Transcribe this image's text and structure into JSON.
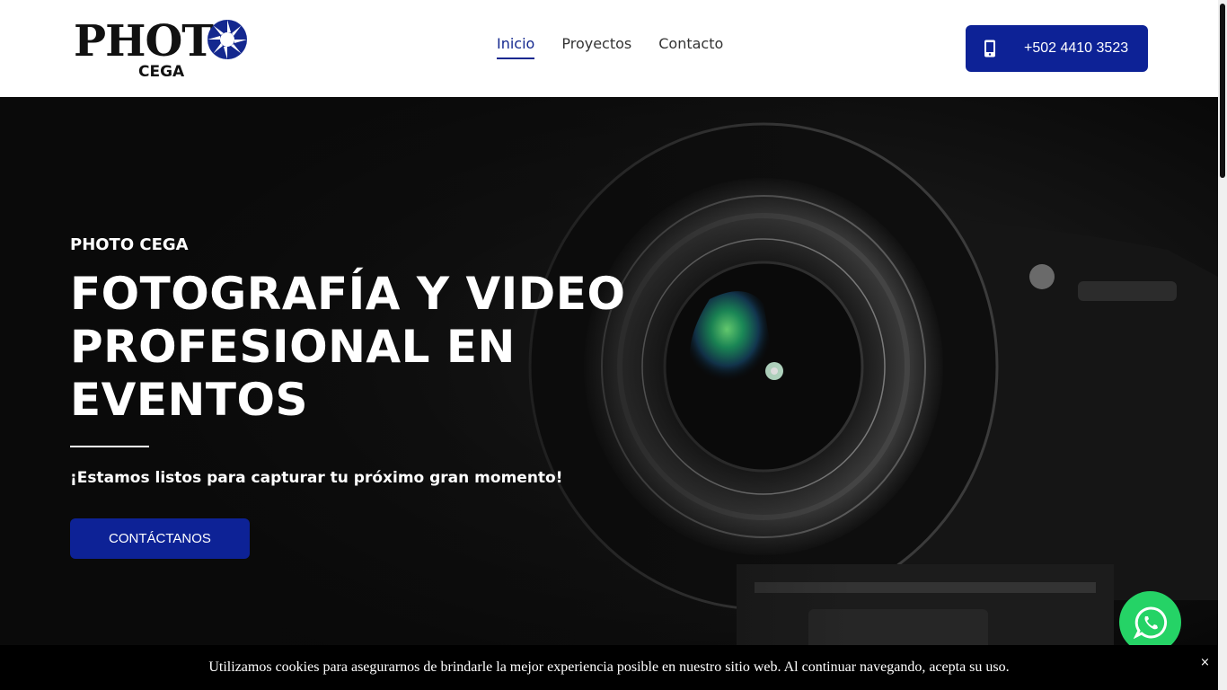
{
  "header": {
    "logo": {
      "word": "PHOT",
      "sub": "CEGA"
    },
    "nav": [
      {
        "label": "Inicio",
        "active": true
      },
      {
        "label": "Proyectos",
        "active": false
      },
      {
        "label": "Contacto",
        "active": false
      }
    ],
    "phone": {
      "label": "+502 4410 3523",
      "icon": "mobile-phone-icon"
    }
  },
  "hero": {
    "kicker": "PHOTO CEGA",
    "title": "FOTOGRAFÍA Y VIDEO PROFESIONAL EN EVENTOS",
    "tagline": "¡Estamos listos para capturar tu próximo gran momento!",
    "cta_label": "CONTÁCTANOS"
  },
  "whatsapp": {
    "icon": "whatsapp-icon"
  },
  "cookie": {
    "text": "Utilizamos cookies para asegurarnos de brindarle la mejor experiencia posible en nuestro sitio web. Al continuar navegando, acepta su uso.",
    "close": "×"
  },
  "colors": {
    "brand": "#0d2296",
    "whatsapp": "#25d366",
    "hero_bg": "#101010"
  }
}
